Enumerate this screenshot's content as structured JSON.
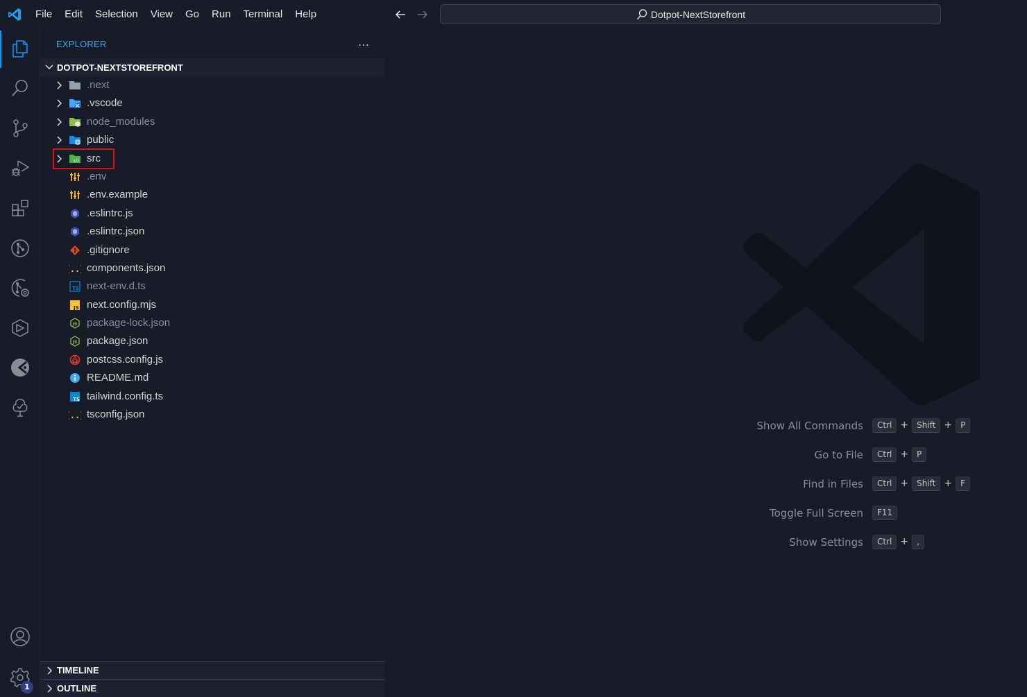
{
  "titlebar": {
    "menu": [
      "File",
      "Edit",
      "Selection",
      "View",
      "Go",
      "Run",
      "Terminal",
      "Help"
    ],
    "command_center": "Dotpot-NextStorefront"
  },
  "activity_bar": {
    "items": [
      {
        "name": "explorer",
        "active": true
      },
      {
        "name": "search"
      },
      {
        "name": "source-control"
      },
      {
        "name": "run-and-debug"
      },
      {
        "name": "extensions"
      },
      {
        "name": "git-graph"
      },
      {
        "name": "git-history"
      },
      {
        "name": "remote"
      },
      {
        "name": "live-share"
      },
      {
        "name": "tree-check"
      }
    ],
    "accounts": "accounts",
    "manage_badge": "1"
  },
  "sidebar": {
    "title": "EXPLORER",
    "more": "…",
    "root": "DOTPOT-NEXTSTOREFRONT",
    "items": [
      {
        "name": ".next",
        "type": "folder",
        "icon": "folder-grey",
        "dim": true
      },
      {
        "name": ".vscode",
        "type": "folder",
        "icon": "folder-vscode"
      },
      {
        "name": "node_modules",
        "type": "folder",
        "icon": "folder-node",
        "dim": true
      },
      {
        "name": "public",
        "type": "folder",
        "icon": "folder-public"
      },
      {
        "name": "src",
        "type": "folder",
        "icon": "folder-src",
        "highlighted": true
      },
      {
        "name": ".env",
        "type": "file",
        "icon": "env",
        "dim": true
      },
      {
        "name": ".env.example",
        "type": "file",
        "icon": "env"
      },
      {
        "name": ".eslintrc.js",
        "type": "file",
        "icon": "eslint"
      },
      {
        "name": ".eslintrc.json",
        "type": "file",
        "icon": "eslint"
      },
      {
        "name": ".gitignore",
        "type": "file",
        "icon": "git"
      },
      {
        "name": "components.json",
        "type": "file",
        "icon": "json"
      },
      {
        "name": "next-env.d.ts",
        "type": "file",
        "icon": "ts-def",
        "dim": true
      },
      {
        "name": "next.config.mjs",
        "type": "file",
        "icon": "js"
      },
      {
        "name": "package-lock.json",
        "type": "file",
        "icon": "node",
        "dim": true
      },
      {
        "name": "package.json",
        "type": "file",
        "icon": "node"
      },
      {
        "name": "postcss.config.js",
        "type": "file",
        "icon": "postcss"
      },
      {
        "name": "README.md",
        "type": "file",
        "icon": "info"
      },
      {
        "name": "tailwind.config.ts",
        "type": "file",
        "icon": "ts"
      },
      {
        "name": "tsconfig.json",
        "type": "file",
        "icon": "json"
      }
    ],
    "timeline": "TIMELINE",
    "outline": "OUTLINE"
  },
  "editor": {
    "shortcuts": [
      {
        "label": "Show All Commands",
        "keys": [
          "Ctrl",
          "Shift",
          "P"
        ]
      },
      {
        "label": "Go to File",
        "keys": [
          "Ctrl",
          "P"
        ]
      },
      {
        "label": "Find in Files",
        "keys": [
          "Ctrl",
          "Shift",
          "F"
        ]
      },
      {
        "label": "Toggle Full Screen",
        "keys": [
          "F11"
        ]
      },
      {
        "label": "Show Settings",
        "keys": [
          "Ctrl",
          ","
        ]
      }
    ]
  },
  "colors": {
    "accent": "#0a98ff",
    "background": "#181b28",
    "highlight_box": "#e01010"
  }
}
